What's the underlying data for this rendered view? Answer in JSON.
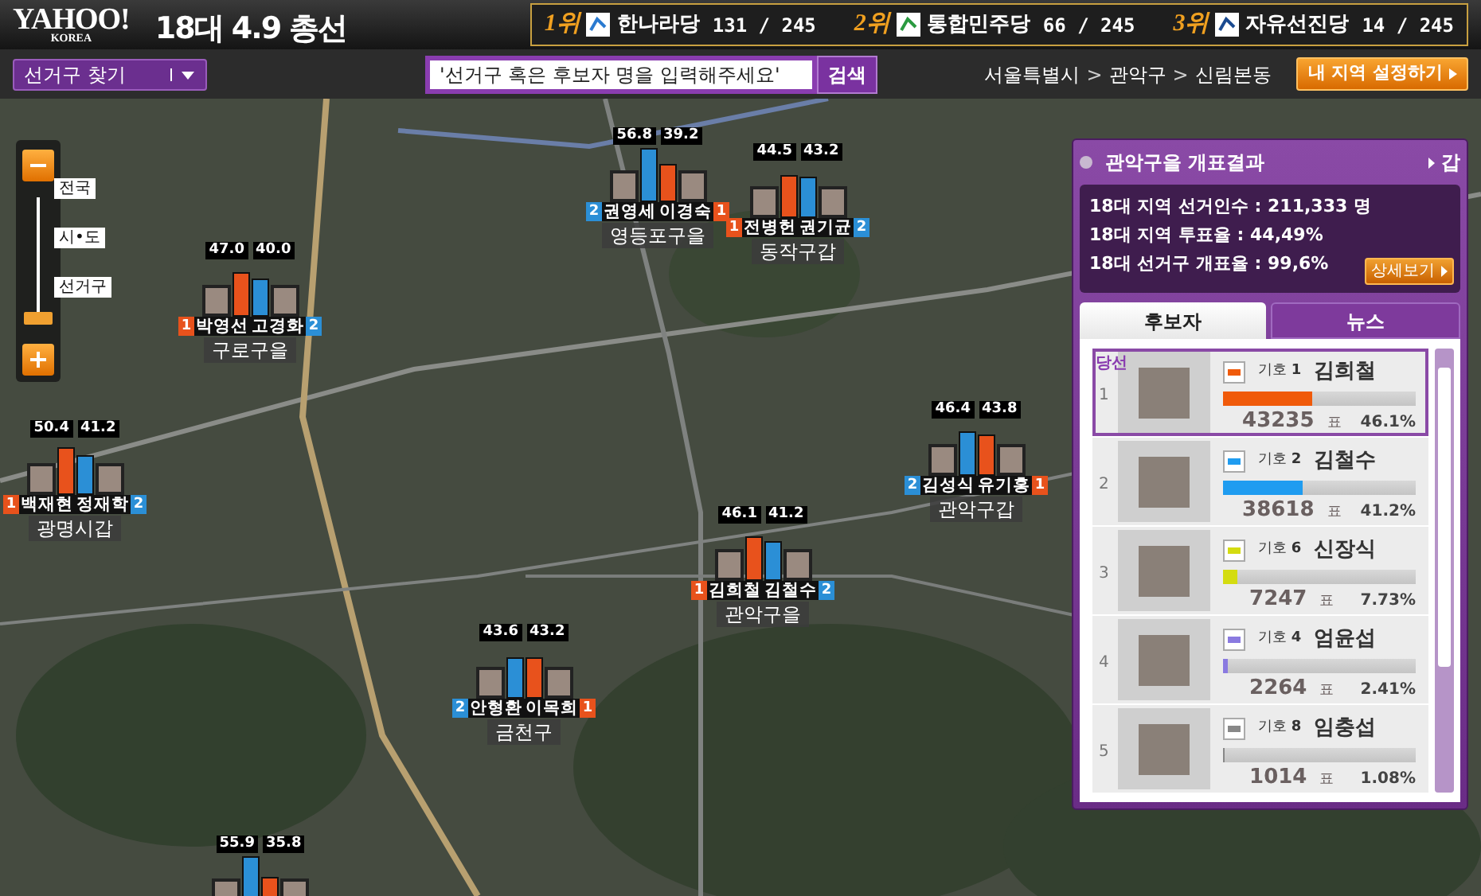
{
  "header": {
    "logo": "YAHOO!",
    "logo_sub": "KOREA",
    "title": "18대 4.9 총선",
    "rankings": [
      {
        "rank": "1위",
        "party": "한나라당",
        "seats": "131 / 245"
      },
      {
        "rank": "2위",
        "party": "통합민주당",
        "seats": "66 / 245"
      },
      {
        "rank": "3위",
        "party": "자유선진당",
        "seats": "14 / 245"
      }
    ]
  },
  "toolbar": {
    "district_finder": "선거구 찾기",
    "search": {
      "placeholder": "'선거구 혹은 후보자 명을 입력해주세요'",
      "button": "검색"
    },
    "breadcrumb": [
      {
        "kind": "link",
        "text": "서울특별시"
      },
      {
        "kind": "separator",
        "text": ">"
      },
      {
        "kind": "link",
        "text": "관악구"
      },
      {
        "kind": "separator",
        "text": ">"
      },
      {
        "kind": "link",
        "text": "신림본동"
      }
    ],
    "region_button": "내 지역 설정하기"
  },
  "zoom_control": {
    "labels": [
      "전국",
      "시•도",
      "선거구"
    ],
    "level": 0.97
  },
  "markers": [
    {
      "district": "구로구을",
      "candidates": [
        {
          "number": "1",
          "name": "박영선",
          "share": "47.0",
          "color": "#e8521c"
        },
        {
          "number": "2",
          "name": "고경화",
          "share": "40.0",
          "color": "#2b8fd6"
        }
      ]
    },
    {
      "district": "광명시갑",
      "candidates": [
        {
          "number": "1",
          "name": "백재현",
          "share": "50.4",
          "color": "#e8521c"
        },
        {
          "number": "2",
          "name": "정재학",
          "share": "41.2",
          "color": "#2b8fd6"
        }
      ]
    },
    {
      "district": "영등포구을",
      "candidates": [
        {
          "number": "2",
          "name": "권영세",
          "share": "56.8",
          "color": "#2b8fd6"
        },
        {
          "number": "1",
          "name": "이경숙",
          "share": "39.2",
          "color": "#e8521c"
        }
      ]
    },
    {
      "district": "동작구갑",
      "candidates": [
        {
          "number": "1",
          "name": "전병헌",
          "share": "44.5",
          "color": "#e8521c"
        },
        {
          "number": "2",
          "name": "권기균",
          "share": "43.2",
          "color": "#2b8fd6"
        }
      ]
    },
    {
      "district": "관악구갑",
      "candidates": [
        {
          "number": "2",
          "name": "김성식",
          "share": "46.4",
          "color": "#2b8fd6"
        },
        {
          "number": "1",
          "name": "유기홍",
          "share": "43.8",
          "color": "#e8521c"
        }
      ]
    },
    {
      "district": "관악구을",
      "candidates": [
        {
          "number": "1",
          "name": "김희철",
          "share": "46.1",
          "color": "#e8521c"
        },
        {
          "number": "2",
          "name": "김철수",
          "share": "41.2",
          "color": "#2b8fd6"
        }
      ]
    },
    {
      "district": "금천구",
      "candidates": [
        {
          "number": "2",
          "name": "안형환",
          "share": "43.6",
          "color": "#2b8fd6"
        },
        {
          "number": "1",
          "name": "이목희",
          "share": "43.2",
          "color": "#e8521c"
        }
      ]
    },
    {
      "candidates": [
        {
          "share": "55.9",
          "color": "#2b8fd6"
        },
        {
          "share": "35.8",
          "color": "#e8521c"
        }
      ]
    }
  ],
  "results_panel": {
    "title": "관악구을 개표결과",
    "switch_link": "갑",
    "stats": [
      "18대 지역 선거인수 : 211,333 명",
      "18대 지역 투표율 : 44,49%",
      "18대 선거구 개표율 : 99,6%"
    ],
    "detail_button": "상세보기",
    "tabs": [
      {
        "label": "후보자",
        "selected": true
      },
      {
        "label": "뉴스",
        "selected": false
      }
    ],
    "candidates": [
      {
        "rank": "1",
        "winner": true,
        "badge": "당선",
        "symbol": "기호 **1**",
        "name": "김희철",
        "level": 0.461,
        "color": "#f05a0a",
        "votes": "43235",
        "unit": "표",
        "percent": "46.1%"
      },
      {
        "rank": "2",
        "winner": false,
        "symbol": "기호 **2**",
        "name": "김철수",
        "level": 0.412,
        "color": "#1f9cf0",
        "votes": "38618",
        "unit": "표",
        "percent": "41.2%"
      },
      {
        "rank": "3",
        "winner": false,
        "symbol": "기호 **6**",
        "name": "신장식",
        "level": 0.0773,
        "color": "#d4dc10",
        "votes": "7247",
        "unit": "표",
        "percent": "7.73%"
      },
      {
        "rank": "4",
        "winner": false,
        "symbol": "기호 **4**",
        "name": "엄윤섭",
        "level": 0.0241,
        "color": "#8a7ae0",
        "votes": "2264",
        "unit": "표",
        "percent": "2.41%"
      },
      {
        "rank": "5",
        "winner": false,
        "symbol": "기호 **8**",
        "name": "임충섭",
        "level": 0.0108,
        "color": "#888888",
        "votes": "1014",
        "unit": "표",
        "percent": "1.08%"
      }
    ]
  }
}
